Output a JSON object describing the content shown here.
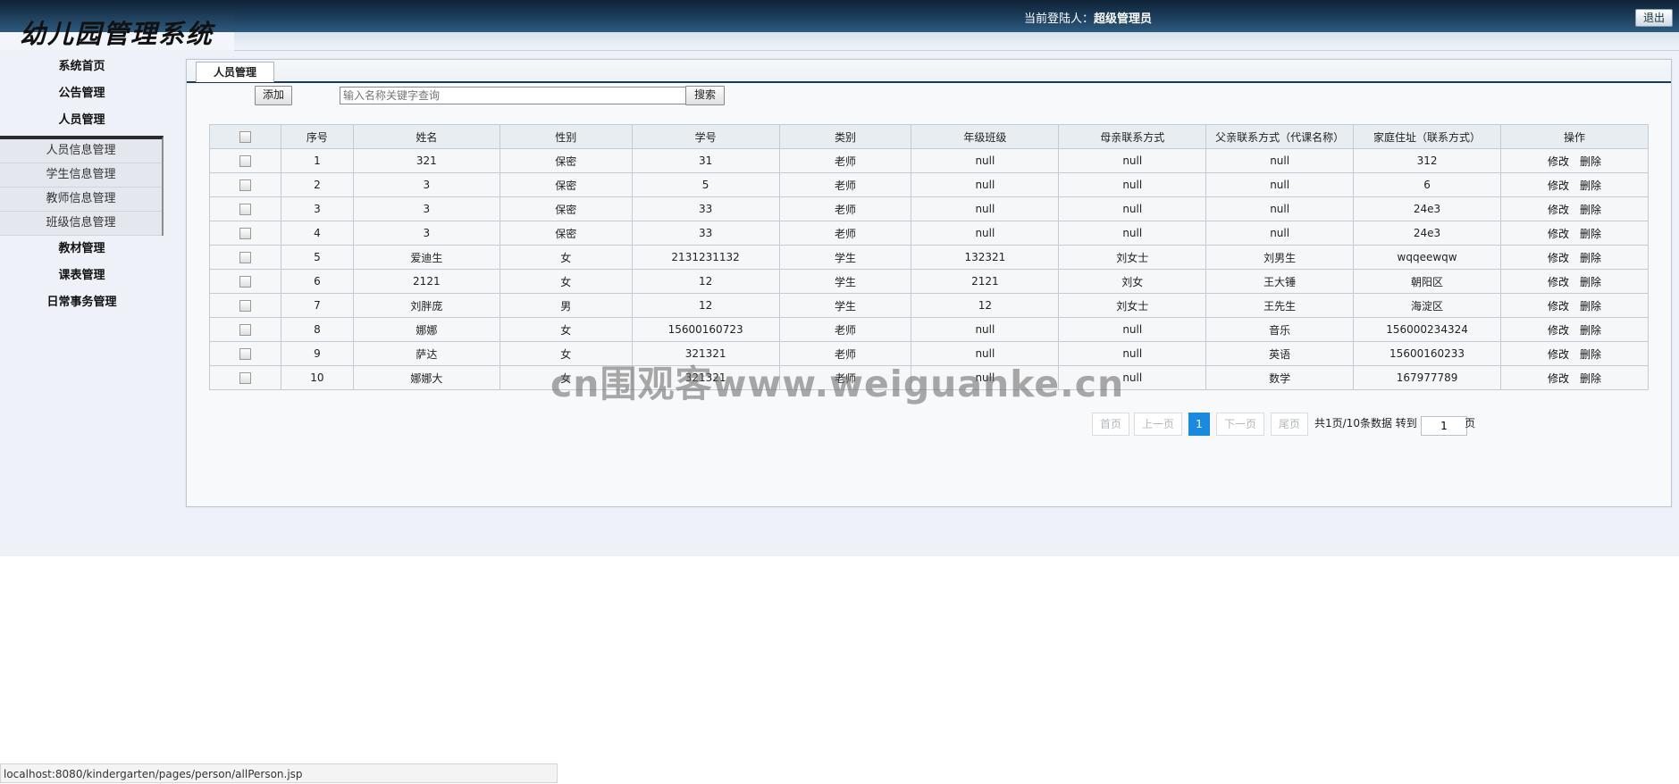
{
  "app": {
    "title": "幼儿园管理系统"
  },
  "header": {
    "login_label": "当前登陆人：",
    "login_user": "超级管理员",
    "logout": "退出"
  },
  "sidebar": {
    "items": [
      "系统首页",
      "公告管理",
      "人员管理",
      "教材管理",
      "课表管理",
      "日常事务管理"
    ],
    "submenu": [
      "人员信息管理",
      "学生信息管理",
      "教师信息管理",
      "班级信息管理"
    ]
  },
  "main": {
    "tab": "人员管理",
    "add_button": "添加",
    "search_placeholder": "输入名称关键字查询",
    "search_button": "搜索"
  },
  "table": {
    "headers": [
      "序号",
      "姓名",
      "性别",
      "学号",
      "类别",
      "年级班级",
      "母亲联系方式",
      "父亲联系方式（代课名称）",
      "家庭住址（联系方式）",
      "操作"
    ],
    "edit_label": "修改",
    "delete_label": "删除",
    "rows": [
      [
        "1",
        "321",
        "保密",
        "31",
        "老师",
        "null",
        "null",
        "null",
        "312"
      ],
      [
        "2",
        "3",
        "保密",
        "5",
        "老师",
        "null",
        "null",
        "null",
        "6"
      ],
      [
        "3",
        "3",
        "保密",
        "33",
        "老师",
        "null",
        "null",
        "null",
        "24e3"
      ],
      [
        "4",
        "3",
        "保密",
        "33",
        "老师",
        "null",
        "null",
        "null",
        "24e3"
      ],
      [
        "5",
        "爱迪生",
        "女",
        "2131231132",
        "学生",
        "132321",
        "刘女士",
        "刘男生",
        "wqqeewqw"
      ],
      [
        "6",
        "2121",
        "女",
        "12",
        "学生",
        "2121",
        "刘女",
        "王大锤",
        "朝阳区"
      ],
      [
        "7",
        "刘胖庞",
        "男",
        "12",
        "学生",
        "12",
        "刘女士",
        "王先生",
        "海淀区"
      ],
      [
        "8",
        "娜娜",
        "女",
        "15600160723",
        "老师",
        "null",
        "null",
        "音乐",
        "156000234324"
      ],
      [
        "9",
        "萨达",
        "女",
        "321321",
        "老师",
        "null",
        "null",
        "英语",
        "15600160233"
      ],
      [
        "10",
        "娜娜大",
        "女",
        "321321",
        "老师",
        "null",
        "null",
        "数学",
        "167977789"
      ]
    ]
  },
  "pager": {
    "first": "首页",
    "prev": "上一页",
    "current": "1",
    "next": "下一页",
    "last": "尾页",
    "summary": "共1页/10条数据",
    "goto_label": "转到",
    "goto_value": "1",
    "page_unit": "页"
  },
  "watermark": "cn围观客www.weiguanke.cn",
  "statusbar": {
    "url": "localhost:8080/kindergarten/pages/person/allPerson.jsp"
  }
}
